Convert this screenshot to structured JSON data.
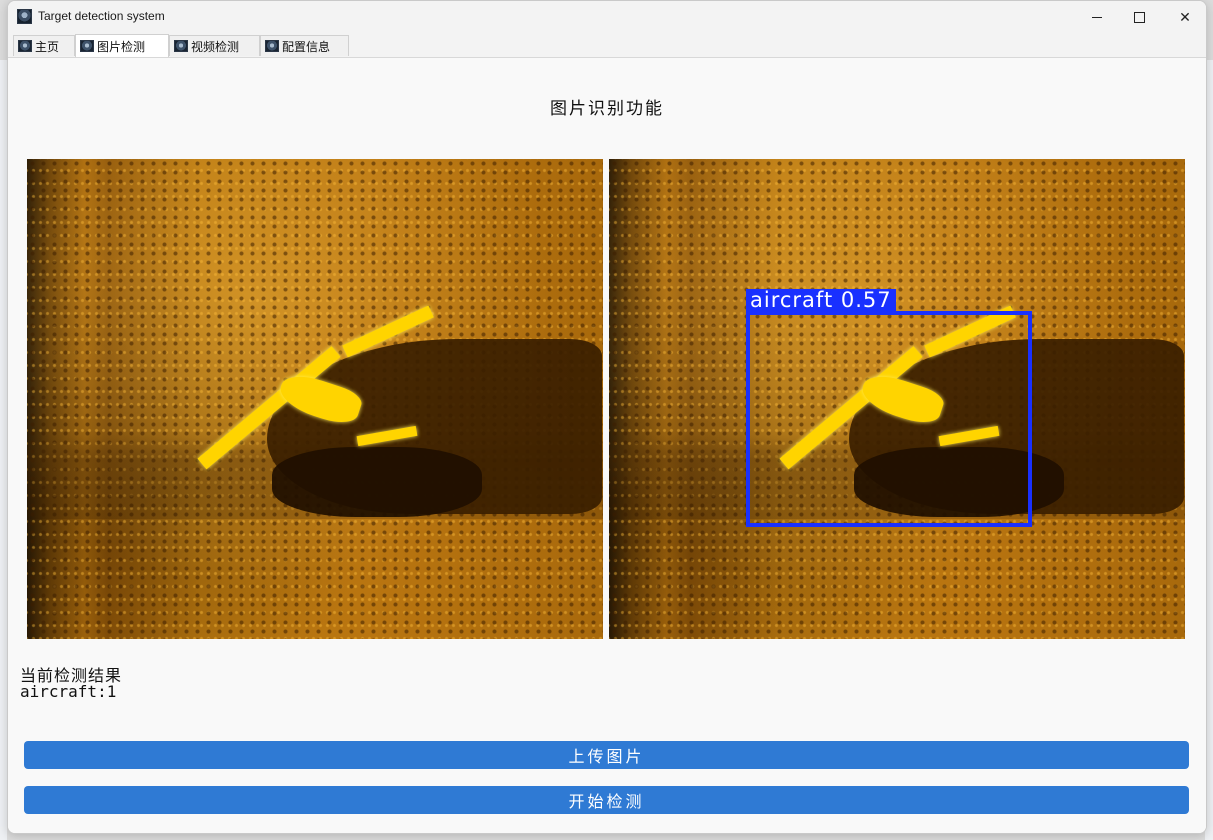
{
  "window": {
    "title": "Target detection system",
    "icon": "app-icon"
  },
  "tabs": [
    {
      "label": "主页",
      "icon": "app-tab-icon",
      "active": false
    },
    {
      "label": "图片检测",
      "icon": "app-tab-icon",
      "active": true
    },
    {
      "label": "视频检测",
      "icon": "app-tab-icon",
      "active": false
    },
    {
      "label": "配置信息",
      "icon": "app-tab-icon",
      "active": false
    }
  ],
  "main": {
    "title": "图片识别功能",
    "detection_label": "aircraft 0.57",
    "result_title": "当前检测结果",
    "result_value": "aircraft:1"
  },
  "buttons": {
    "upload": "上传图片",
    "detect": "开始检测"
  },
  "colors": {
    "accent": "#2f7ad4",
    "detection_box": "#1930ff"
  }
}
